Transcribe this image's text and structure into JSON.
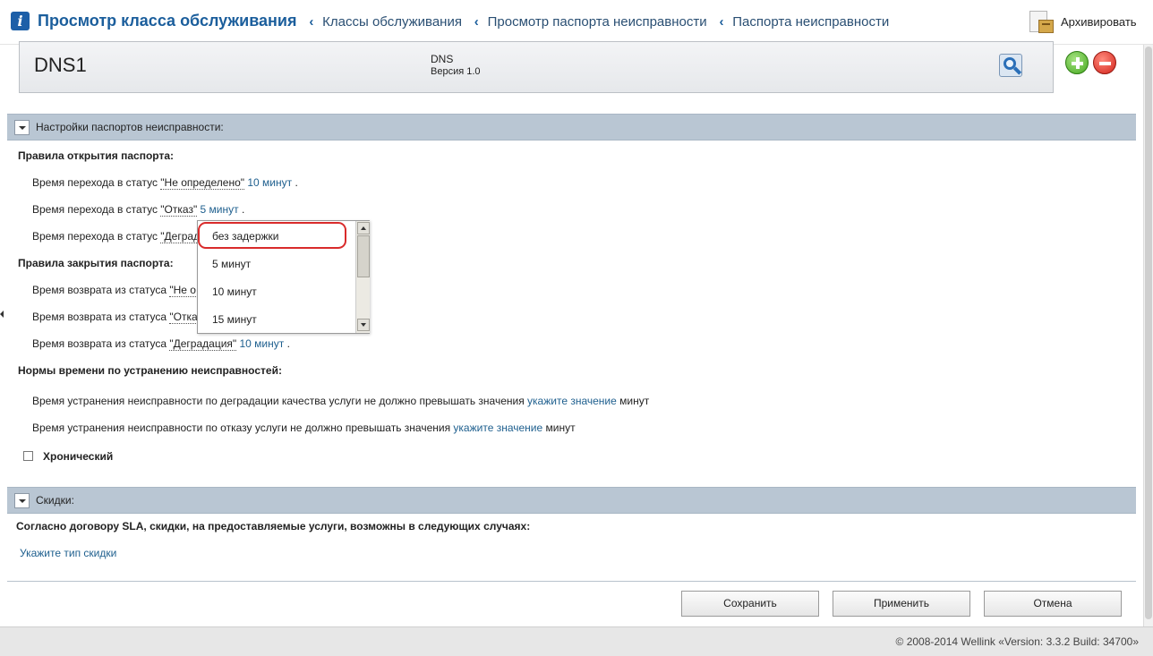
{
  "header": {
    "title": "Просмотр класса обслуживания",
    "breadcrumbs": [
      "Классы обслуживания",
      "Просмотр паспорта неисправности",
      "Паспорта неисправности"
    ],
    "archive_label": "Архивировать"
  },
  "entity": {
    "name": "DNS1",
    "type": "DNS",
    "version": "Версия 1.0"
  },
  "passport_settings": {
    "section_title": "Настройки паспортов неисправности:",
    "open_rules_title": "Правила открытия паспорта:",
    "open_rules": [
      {
        "prefix": "Время перехода в статус ",
        "status": "\"Не определено\"",
        "value": "10 минут",
        "suffix": "."
      },
      {
        "prefix": "Время перехода в статус ",
        "status": "\"Отказ\"",
        "value": "5 минут",
        "suffix": "."
      },
      {
        "prefix": "Время перехода в статус ",
        "status": "\"Деграда"
      }
    ],
    "close_rules_title": "Правила закрытия паспорта:",
    "close_rules": [
      {
        "prefix": "Время возврата из статуса ",
        "status": "\"Не о"
      },
      {
        "prefix": "Время возврата из статуса ",
        "status": "\"Отка"
      },
      {
        "prefix": "Время возврата из статуса ",
        "status": "\"Деградация\"",
        "value": "10 минут",
        "suffix": "."
      }
    ],
    "norms_title": "Нормы времени по устранению неисправностей:",
    "norms": [
      {
        "text": "Время устранения неисправности по деградации качества услуги не должно превышать значения ",
        "link": "укажите значение",
        "suffix": "минут"
      },
      {
        "text": "Время устранения неисправности по отказу услуги не должно превышать значения ",
        "link": "укажите значение",
        "suffix": "минут"
      }
    ],
    "chronic_label": "Хронический",
    "chronic_checked": false
  },
  "dropdown": {
    "options": [
      "без задержки",
      "5 минут",
      "10 минут",
      "15 минут"
    ],
    "highlighted": "без задержки",
    "highlight_color": "#d92b2b"
  },
  "discounts": {
    "section_title": "Скидки:",
    "description": "Согласно договору SLA, скидки, на предоставляемые услуги, возможны в следующих случаях:",
    "link": "Укажите тип скидки"
  },
  "buttons": {
    "save": "Сохранить",
    "apply": "Применить",
    "cancel": "Отмена"
  },
  "footer": {
    "copyright": "© 2008-2014 Wellink «Version: 3.3.2 Build: 34700»"
  },
  "icons": {
    "info": "info-icon",
    "archive": "archive-icon",
    "search": "search-icon",
    "add": "add-icon",
    "remove": "remove-icon",
    "collapse": "chevron-down-icon"
  },
  "colors": {
    "title": "#1b5e9c",
    "link": "#1e5f8e",
    "section_bar": "#b9c6d3",
    "add": "#45a81f",
    "remove": "#d3221a"
  }
}
